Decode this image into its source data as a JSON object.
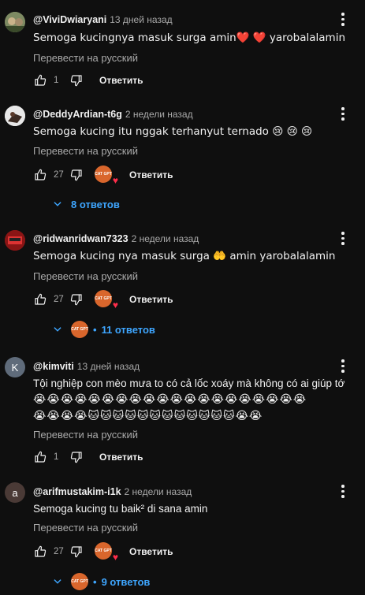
{
  "labels": {
    "translate": "Перевести на русский",
    "reply": "Ответить"
  },
  "comments": [
    {
      "avatar_type": "photo",
      "handle": "@ViviDwiaryani",
      "time": "13 дней назад",
      "text": "Semoga kucingnya masuk surga amin❤️ ❤️  yarobalalamin",
      "likes": "1",
      "creator_heart": false
    },
    {
      "avatar_type": "photo",
      "handle": "@DeddyArdian-t6g",
      "time": "2 недели назад",
      "text": "Semoga kucing itu nggak terhanyut ternado 😢 😢 😢",
      "likes": "27",
      "creator_heart": true,
      "replies": "8 ответов"
    },
    {
      "avatar_type": "photo",
      "handle": "@ridwanridwan7323",
      "time": "2 недели назад",
      "text": "Semoga kucing nya masuk surga 🤲 amin yarobalalamin",
      "likes": "27",
      "creator_heart": true,
      "replies": "11 ответов"
    },
    {
      "avatar_type": "letter",
      "avatar_letter": "K",
      "handle": "@kimviti",
      "time": "13 дней назад",
      "text_line1": "Tội nghiệp con mèo mưa to có cả lốc xoáy mà không có ai giúp tớ",
      "text_line2": "😭😭😭😭😭😭😭😭😭😭😭😭😭😭😭😭😭😭😭😭",
      "text_line3": "😭😭😭😭🐱🐱🐱🐱🐱🐱🐱🐱🐱🐱🐱🐱😭😭",
      "likes": "1",
      "creator_heart": false
    },
    {
      "avatar_type": "letter",
      "avatar_letter": "a",
      "handle": "@arifmustakim-i1k",
      "time": "2 недели назад",
      "text": "Semoga kucing tu baik² di sana amin",
      "likes": "27",
      "creator_heart": true,
      "replies": "9 ответов"
    }
  ],
  "creator_badge": "CAT GPT",
  "colors": {
    "background": "#0f0f0f",
    "link": "#3ea6ff",
    "heart": "#ff2d4a",
    "secondary_text": "#aaaaaa"
  }
}
